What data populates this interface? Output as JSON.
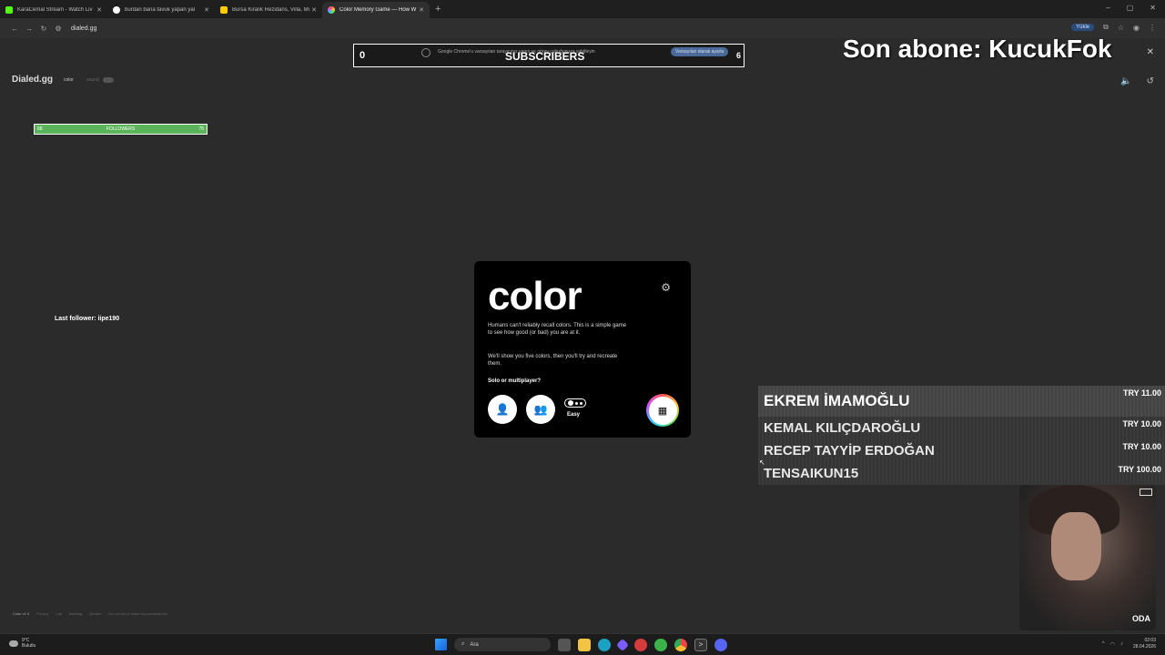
{
  "browser": {
    "tabs": [
      {
        "title": "KaraCemal Stream - Watch Liv",
        "fav_color": "#53fc18",
        "active": false
      },
      {
        "title": "burdan bana tavuk yapan yal",
        "fav_color": "#ffffff",
        "active": false
      },
      {
        "title": "Bursa Kiralık Rezidans, Villa, Mi",
        "fav_color": "#ffcc00",
        "active": false
      },
      {
        "title": "Color Memory Game — How W",
        "fav_color": "#b060ff",
        "active": true
      }
    ],
    "new_tab": "+",
    "url": "dialed.gg",
    "update_label": "Yükle",
    "window_controls": [
      "–",
      "▢",
      "✕"
    ]
  },
  "overlay": {
    "subscribers_count": "0",
    "subscribers_label": "SUBSCRIBERS",
    "subscribers_goal": "6",
    "chrome_banner": "Google Chrome'u varsayılan tarayıcınız yapın ve görev çubuğunuza sabitleyin",
    "chrome_banner_button": "Varsayılan olarak ayarla",
    "last_subscriber": "Son abone: KucukFok",
    "followers_bar": {
      "label": "FOLLOWERS",
      "current": "68",
      "goal": "75",
      "progress": 1.0
    },
    "last_follower": "Last follower: iipe190",
    "donations": [
      {
        "name": "EKREM İMAMOĞLU",
        "amount": "TRY 11.00"
      },
      {
        "name": "KEMAL KILIÇDAROĞLU",
        "amount": "TRY 10.00"
      },
      {
        "name": "RECEP TAYYİP ERDOĞAN",
        "amount": "TRY 10.00"
      },
      {
        "name": "TENSAIKUN15",
        "amount": "TRY 100.00"
      }
    ],
    "webcam_label": "ODA"
  },
  "site": {
    "brand": "Dialed.gg",
    "nav": [
      "color",
      "sound"
    ]
  },
  "game": {
    "title": "color",
    "intro1": "Humans can't reliably recall colors. This is a simple game to see how good (or bad) you are at it.",
    "intro2": "We'll show you five colors, then you'll try and recreate them.",
    "question": "Solo or multiplayer?",
    "difficulty": "Easy"
  },
  "footer": [
    "Color v1.0",
    "Privacy",
    "Lab",
    "Backlog",
    "Quotes",
    "Do not sell or share my personal info"
  ],
  "taskbar": {
    "weather_temp": "9°C",
    "weather_desc": "Bulutlu",
    "search_label": "Ara",
    "time": "02:03",
    "date": "28.04.2026"
  }
}
